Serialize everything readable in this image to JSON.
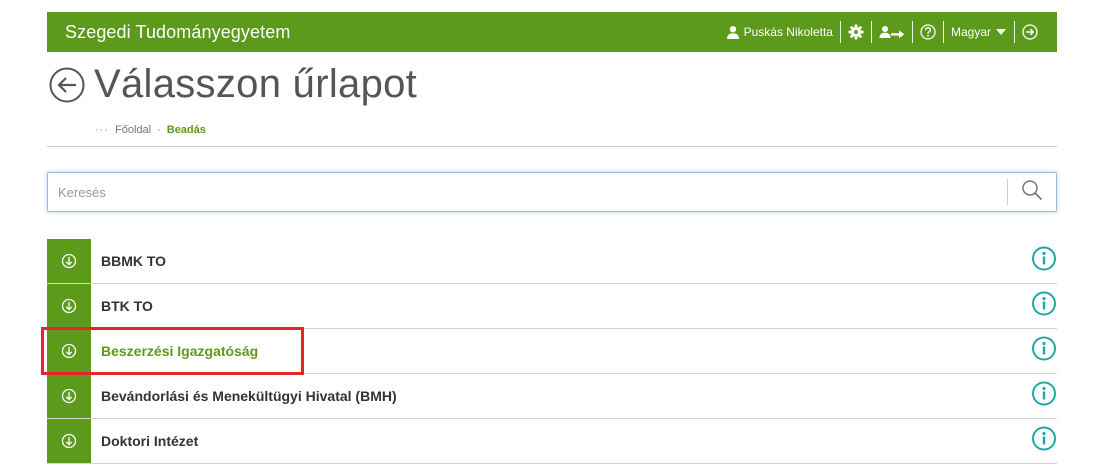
{
  "header": {
    "brand": "Szegedi Tudományegyetem",
    "user_name": "Puskás Nikoletta",
    "language": "Magyar"
  },
  "page": {
    "title": "Válasszon űrlapot",
    "breadcrumb": {
      "ellipsis": "···",
      "home": "Főoldal",
      "separator": "·",
      "current": "Beadás"
    }
  },
  "search": {
    "placeholder": "Keresés",
    "value": ""
  },
  "list": {
    "items": [
      {
        "label": "BBMK TO"
      },
      {
        "label": "BTK TO"
      },
      {
        "label": "Beszerzési Igazgatóság",
        "highlighted": true
      },
      {
        "label": "Bevándorlási és Menekültügyi Hivatal (BMH)"
      },
      {
        "label": "Doktori Intézet"
      }
    ]
  },
  "colors": {
    "brand_green": "#5c9a1b",
    "info_teal": "#1fa6a6",
    "highlight_red": "#e8232a"
  }
}
